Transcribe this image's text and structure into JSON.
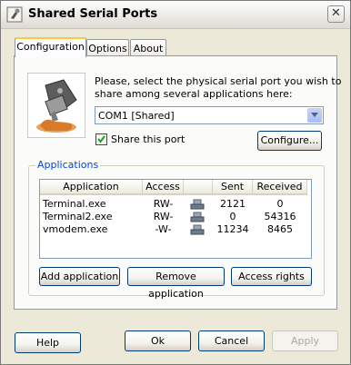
{
  "window": {
    "title": "Shared Serial Ports",
    "close_symbol": "✕"
  },
  "tabs": [
    {
      "label": "Configuration",
      "active": true
    },
    {
      "label": "Options",
      "active": false
    },
    {
      "label": "About",
      "active": false
    }
  ],
  "config": {
    "instruction": [
      "Please, select the physical serial port you wish to",
      "share among several applications here:"
    ],
    "port_select": {
      "value": "COM1 [Shared]"
    },
    "share_checkbox": {
      "label": "Share this port",
      "checked": true
    },
    "configure_button": "Configure..."
  },
  "applications": {
    "group_title": "Applications",
    "columns": [
      "Application",
      "Access",
      "",
      "Sent",
      "Received"
    ],
    "rows": [
      {
        "application": "Terminal.exe",
        "access": "RW-",
        "icon": "serial-port-icon",
        "sent": "2121",
        "received": "0"
      },
      {
        "application": "Terminal2.exe",
        "access": "RW-",
        "icon": "serial-port-icon",
        "sent": "0",
        "received": "54316"
      },
      {
        "application": "vmodem.exe",
        "access": "-W-",
        "icon": "serial-port-icon",
        "sent": "11234",
        "received": "8465"
      }
    ],
    "buttons": {
      "add": "Add application",
      "remove": "Remove application",
      "rights": "Access rights"
    }
  },
  "footer": {
    "help": "Help",
    "ok": "Ok",
    "cancel": "Cancel",
    "apply": "Apply"
  },
  "colors": {
    "accent_tab": "#FFC83C",
    "group_title": "#0046D5",
    "window_bg": "#ECE9D8",
    "panel_bg": "#FBFBF9"
  }
}
